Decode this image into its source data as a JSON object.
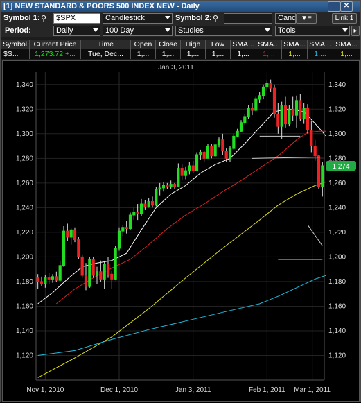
{
  "window": {
    "title": "[1] NEW STANDARD & POORS 500 INDEX NEW - Daily"
  },
  "toolbar": {
    "symbol1_label": "Symbol 1:",
    "symbol1_value": "$SPX",
    "chart_type": "Candlestick",
    "symbol2_label": "Symbol 2:",
    "symbol2_value": "",
    "cand_btn": "Canc",
    "link_btn": "Link 1",
    "period_label": "Period:",
    "period_value": "Daily",
    "range_value": "100 Day",
    "studies_value": "Studies",
    "tools_value": "Tools"
  },
  "quote": {
    "headers": [
      "Symbol",
      "Current Price",
      "Time",
      "Open",
      "Close",
      "High",
      "Low",
      "SMA...",
      "SMA...",
      "SMA...",
      "SMA...",
      "SMA..."
    ],
    "values": [
      "$S...",
      "1,273.72",
      "+...",
      "Tue, Dec...",
      "1,...",
      "1,...",
      "1,...",
      "1,...",
      "1,...",
      "1,...",
      "1,...",
      "1,...",
      "1,..."
    ]
  },
  "colors": {
    "up": "#22dd22",
    "down": "#ee2222",
    "sma_white": "#ffffff",
    "sma_red": "#dd2222",
    "sma_yellow": "#dddd22",
    "sma_cyan": "#22bbdd",
    "price_tag": "#22aa44"
  },
  "chart_data": {
    "type": "candlestick",
    "title": "",
    "top_date_label": "Jan 3, 2011",
    "price_tag": "1,274",
    "xlabel": "",
    "ylabel": "",
    "ylim": [
      1100,
      1350
    ],
    "y_ticks": [
      "1,340",
      "1,320",
      "1,300",
      "1,280",
      "1,260",
      "1,240",
      "1,220",
      "1,200",
      "1,180",
      "1,160",
      "1,140",
      "1,120"
    ],
    "x_ticks": [
      "Nov 1, 2010",
      "Dec 1, 2010",
      "Jan 3, 2011",
      "Feb 1, 2011",
      "Mar 1, 2011"
    ],
    "candles": [
      {
        "o": 1183,
        "h": 1186,
        "l": 1174,
        "c": 1180
      },
      {
        "o": 1180,
        "h": 1184,
        "l": 1176,
        "c": 1178
      },
      {
        "o": 1178,
        "h": 1185,
        "l": 1175,
        "c": 1183
      },
      {
        "o": 1183,
        "h": 1187,
        "l": 1178,
        "c": 1182
      },
      {
        "o": 1182,
        "h": 1186,
        "l": 1179,
        "c": 1184
      },
      {
        "o": 1184,
        "h": 1188,
        "l": 1180,
        "c": 1181
      },
      {
        "o": 1181,
        "h": 1197,
        "l": 1180,
        "c": 1193
      },
      {
        "o": 1193,
        "h": 1225,
        "l": 1192,
        "c": 1221
      },
      {
        "o": 1221,
        "h": 1227,
        "l": 1213,
        "c": 1216
      },
      {
        "o": 1216,
        "h": 1223,
        "l": 1210,
        "c": 1222
      },
      {
        "o": 1222,
        "h": 1224,
        "l": 1212,
        "c": 1214
      },
      {
        "o": 1214,
        "h": 1216,
        "l": 1198,
        "c": 1200
      },
      {
        "o": 1200,
        "h": 1202,
        "l": 1183,
        "c": 1185
      },
      {
        "o": 1185,
        "h": 1195,
        "l": 1173,
        "c": 1176
      },
      {
        "o": 1176,
        "h": 1200,
        "l": 1175,
        "c": 1198
      },
      {
        "o": 1198,
        "h": 1200,
        "l": 1183,
        "c": 1185
      },
      {
        "o": 1185,
        "h": 1192,
        "l": 1178,
        "c": 1188
      },
      {
        "o": 1188,
        "h": 1197,
        "l": 1180,
        "c": 1182
      },
      {
        "o": 1182,
        "h": 1196,
        "l": 1174,
        "c": 1194
      },
      {
        "o": 1194,
        "h": 1200,
        "l": 1183,
        "c": 1186
      },
      {
        "o": 1186,
        "h": 1189,
        "l": 1174,
        "c": 1182
      },
      {
        "o": 1182,
        "h": 1209,
        "l": 1181,
        "c": 1207
      },
      {
        "o": 1207,
        "h": 1224,
        "l": 1205,
        "c": 1221
      },
      {
        "o": 1221,
        "h": 1226,
        "l": 1217,
        "c": 1224
      },
      {
        "o": 1224,
        "h": 1229,
        "l": 1219,
        "c": 1223
      },
      {
        "o": 1223,
        "h": 1236,
        "l": 1222,
        "c": 1234
      },
      {
        "o": 1234,
        "h": 1240,
        "l": 1230,
        "c": 1236
      },
      {
        "o": 1236,
        "h": 1243,
        "l": 1230,
        "c": 1235
      },
      {
        "o": 1235,
        "h": 1247,
        "l": 1233,
        "c": 1243
      },
      {
        "o": 1243,
        "h": 1246,
        "l": 1238,
        "c": 1241
      },
      {
        "o": 1241,
        "h": 1248,
        "l": 1240,
        "c": 1245
      },
      {
        "o": 1245,
        "h": 1249,
        "l": 1240,
        "c": 1242
      },
      {
        "o": 1242,
        "h": 1257,
        "l": 1241,
        "c": 1255
      },
      {
        "o": 1255,
        "h": 1260,
        "l": 1250,
        "c": 1256
      },
      {
        "o": 1256,
        "h": 1261,
        "l": 1253,
        "c": 1258
      },
      {
        "o": 1258,
        "h": 1260,
        "l": 1255,
        "c": 1257
      },
      {
        "o": 1257,
        "h": 1262,
        "l": 1255,
        "c": 1259
      },
      {
        "o": 1259,
        "h": 1260,
        "l": 1255,
        "c": 1257
      },
      {
        "o": 1257,
        "h": 1276,
        "l": 1257,
        "c": 1272
      },
      {
        "o": 1272,
        "h": 1275,
        "l": 1262,
        "c": 1266
      },
      {
        "o": 1266,
        "h": 1273,
        "l": 1263,
        "c": 1270
      },
      {
        "o": 1270,
        "h": 1277,
        "l": 1267,
        "c": 1274
      },
      {
        "o": 1274,
        "h": 1278,
        "l": 1268,
        "c": 1270
      },
      {
        "o": 1270,
        "h": 1285,
        "l": 1270,
        "c": 1283
      },
      {
        "o": 1283,
        "h": 1287,
        "l": 1279,
        "c": 1285
      },
      {
        "o": 1285,
        "h": 1286,
        "l": 1277,
        "c": 1280
      },
      {
        "o": 1280,
        "h": 1292,
        "l": 1280,
        "c": 1290
      },
      {
        "o": 1290,
        "h": 1292,
        "l": 1280,
        "c": 1282
      },
      {
        "o": 1282,
        "h": 1292,
        "l": 1281,
        "c": 1291
      },
      {
        "o": 1291,
        "h": 1297,
        "l": 1289,
        "c": 1295
      },
      {
        "o": 1295,
        "h": 1300,
        "l": 1283,
        "c": 1286
      },
      {
        "o": 1286,
        "h": 1288,
        "l": 1277,
        "c": 1280
      },
      {
        "o": 1280,
        "h": 1290,
        "l": 1277,
        "c": 1288
      },
      {
        "o": 1288,
        "h": 1300,
        "l": 1287,
        "c": 1298
      },
      {
        "o": 1298,
        "h": 1304,
        "l": 1297,
        "c": 1302
      },
      {
        "o": 1302,
        "h": 1311,
        "l": 1301,
        "c": 1309
      },
      {
        "o": 1309,
        "h": 1316,
        "l": 1307,
        "c": 1314
      },
      {
        "o": 1314,
        "h": 1323,
        "l": 1312,
        "c": 1321
      },
      {
        "o": 1321,
        "h": 1325,
        "l": 1315,
        "c": 1319
      },
      {
        "o": 1319,
        "h": 1330,
        "l": 1318,
        "c": 1328
      },
      {
        "o": 1328,
        "h": 1334,
        "l": 1325,
        "c": 1331
      },
      {
        "o": 1331,
        "h": 1340,
        "l": 1328,
        "c": 1338
      },
      {
        "o": 1338,
        "h": 1343,
        "l": 1335,
        "c": 1341
      },
      {
        "o": 1341,
        "h": 1344,
        "l": 1334,
        "c": 1337
      },
      {
        "o": 1337,
        "h": 1340,
        "l": 1313,
        "c": 1316
      },
      {
        "o": 1316,
        "h": 1325,
        "l": 1300,
        "c": 1306
      },
      {
        "o": 1306,
        "h": 1326,
        "l": 1296,
        "c": 1323
      },
      {
        "o": 1323,
        "h": 1330,
        "l": 1305,
        "c": 1308
      },
      {
        "o": 1308,
        "h": 1323,
        "l": 1306,
        "c": 1320
      },
      {
        "o": 1320,
        "h": 1330,
        "l": 1310,
        "c": 1315
      },
      {
        "o": 1315,
        "h": 1331,
        "l": 1305,
        "c": 1327
      },
      {
        "o": 1327,
        "h": 1332,
        "l": 1310,
        "c": 1312
      },
      {
        "o": 1312,
        "h": 1325,
        "l": 1308,
        "c": 1321
      },
      {
        "o": 1321,
        "h": 1324,
        "l": 1300,
        "c": 1303
      },
      {
        "o": 1303,
        "h": 1310,
        "l": 1285,
        "c": 1290
      },
      {
        "o": 1290,
        "h": 1295,
        "l": 1278,
        "c": 1282
      },
      {
        "o": 1282,
        "h": 1283,
        "l": 1255,
        "c": 1257
      },
      {
        "o": 1257,
        "h": 1277,
        "l": 1249,
        "c": 1274
      }
    ],
    "sma_series": [
      {
        "color": "white",
        "values": [
          [
            0,
            1162
          ],
          [
            4,
            1171
          ],
          [
            8,
            1182
          ],
          [
            12,
            1192
          ],
          [
            16,
            1195
          ],
          [
            20,
            1197
          ],
          [
            24,
            1203
          ],
          [
            28,
            1222
          ],
          [
            32,
            1240
          ],
          [
            36,
            1251
          ],
          [
            40,
            1258
          ],
          [
            44,
            1268
          ],
          [
            48,
            1275
          ],
          [
            52,
            1280
          ],
          [
            56,
            1292
          ],
          [
            60,
            1305
          ],
          [
            64,
            1318
          ],
          [
            68,
            1320
          ],
          [
            72,
            1318
          ],
          [
            76,
            1305
          ],
          [
            78,
            1298
          ]
        ]
      },
      {
        "color": "red",
        "values": [
          [
            5,
            1162
          ],
          [
            10,
            1174
          ],
          [
            15,
            1183
          ],
          [
            20,
            1191
          ],
          [
            25,
            1198
          ],
          [
            30,
            1210
          ],
          [
            35,
            1223
          ],
          [
            40,
            1234
          ],
          [
            45,
            1243
          ],
          [
            50,
            1253
          ],
          [
            55,
            1262
          ],
          [
            60,
            1272
          ],
          [
            65,
            1282
          ],
          [
            70,
            1295
          ],
          [
            73,
            1301
          ],
          [
            76,
            1302
          ],
          [
            78,
            1302
          ]
        ]
      },
      {
        "color": "yellow",
        "values": [
          [
            0,
            1102
          ],
          [
            10,
            1118
          ],
          [
            20,
            1135
          ],
          [
            30,
            1158
          ],
          [
            40,
            1183
          ],
          [
            50,
            1207
          ],
          [
            60,
            1230
          ],
          [
            65,
            1242
          ],
          [
            70,
            1251
          ],
          [
            75,
            1258
          ],
          [
            78,
            1261
          ]
        ]
      },
      {
        "color": "cyan",
        "values": [
          [
            0,
            1120
          ],
          [
            10,
            1124
          ],
          [
            20,
            1133
          ],
          [
            30,
            1141
          ],
          [
            40,
            1148
          ],
          [
            50,
            1155
          ],
          [
            60,
            1162
          ],
          [
            65,
            1168
          ],
          [
            70,
            1175
          ],
          [
            75,
            1182
          ],
          [
            78,
            1185
          ]
        ]
      }
    ],
    "drawn_lines": [
      {
        "x1": 60,
        "y1": 1298,
        "x2": 71,
        "y2": 1298
      },
      {
        "x1": 58,
        "y1": 1280,
        "x2": 78,
        "y2": 1281
      },
      {
        "x1": 73,
        "y1": 1226,
        "x2": 77,
        "y2": 1209
      },
      {
        "x1": 65,
        "y1": 1198,
        "x2": 77,
        "y2": 1198
      }
    ]
  }
}
